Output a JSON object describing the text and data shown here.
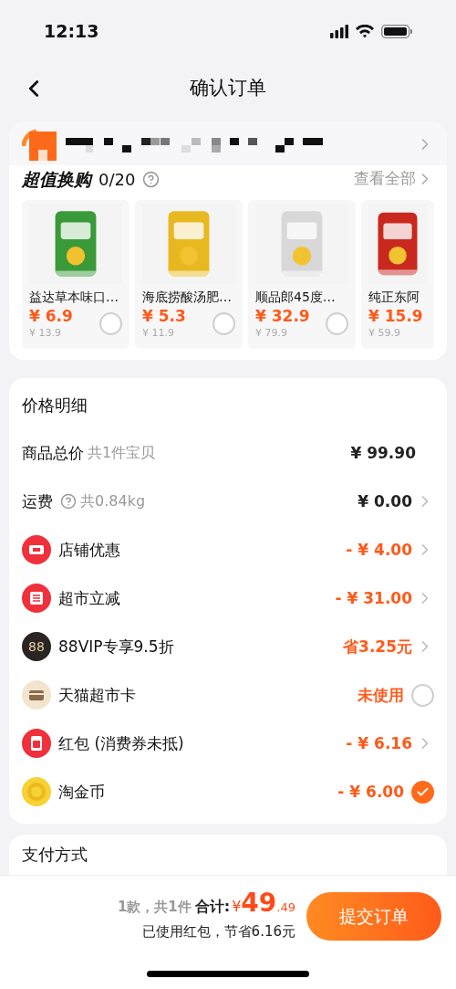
{
  "status_bar": {
    "time": "12:13"
  },
  "nav": {
    "title": "确认订单"
  },
  "exchange": {
    "title": "超值换购",
    "count": "0/20",
    "view_all": "查看全部",
    "products": [
      {
        "name": "益达草本味口…",
        "price": "¥ 6.9",
        "original": "¥ 13.9",
        "selected": false
      },
      {
        "name": "海底捞酸汤肥…",
        "price": "¥ 5.3",
        "original": "¥ 11.9",
        "selected": false
      },
      {
        "name": "顺品郎45度…",
        "price": "¥ 32.9",
        "original": "¥ 79.9",
        "selected": false
      },
      {
        "name": "纯正东阿",
        "price": "¥ 15.9",
        "original": "¥ 59.9"
      }
    ]
  },
  "price_detail": {
    "title": "价格明细",
    "rows": [
      {
        "kind": "plain",
        "label": "商品总价",
        "note": "共1件宝贝",
        "value": "¥ 99.90",
        "emphasis": false
      },
      {
        "kind": "help",
        "label": "运费",
        "note": "共0.84kg",
        "value": "¥ 0.00",
        "emphasis": false,
        "chevron": true
      },
      {
        "kind": "ticket",
        "label": "店铺优惠",
        "value": "- ¥ 4.00",
        "emphasis": true,
        "chevron": true
      },
      {
        "kind": "market",
        "label": "超市立减",
        "value": "- ¥ 31.00",
        "emphasis": true,
        "chevron": true
      },
      {
        "kind": "vip",
        "badge": "88",
        "label": "88VIP专享9.5折",
        "value": "省3.25元",
        "emphasis": true,
        "chevron": true
      },
      {
        "kind": "card",
        "label": "天猫超市卡",
        "value": "未使用",
        "emphasis": true,
        "checked": false
      },
      {
        "kind": "packet",
        "label": "红包 (消费券未抵)",
        "value": "- ¥ 6.16",
        "emphasis": true,
        "chevron": true
      },
      {
        "kind": "coin",
        "label": "淘金币",
        "value": "- ¥ 6.00",
        "emphasis": true,
        "checked": true
      }
    ]
  },
  "payment": {
    "title": "支付方式"
  },
  "footer": {
    "count": "1款，共1件",
    "total_label": "合计:",
    "currency": "¥",
    "integer": "49",
    "decimal": ".49",
    "saving": "已使用红包，节省6.16元",
    "submit": "提交订单"
  }
}
